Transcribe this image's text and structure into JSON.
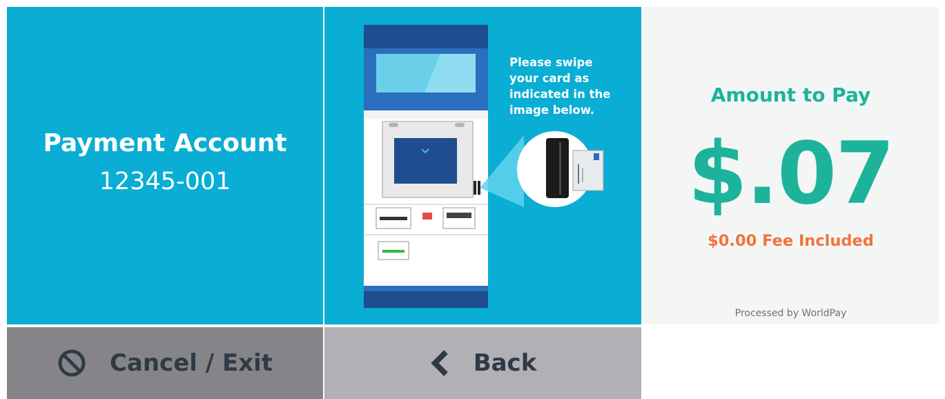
{
  "account": {
    "title": "Payment Account",
    "number": "12345-001"
  },
  "instructions": {
    "swipe_text": "Please swipe\nyour card as\nindicated in the\nimage below."
  },
  "payment": {
    "amount_label": "Amount to Pay",
    "amount": "$.07",
    "fee": "$0.00 Fee Included",
    "processor": "Processed by WorldPay"
  },
  "buttons": {
    "cancel_label": "Cancel / Exit",
    "back_label": "Back"
  },
  "icons": {
    "cancel": "no-entry-icon",
    "back": "chevron-left-icon"
  },
  "colors": {
    "panel_blue": "#0aadd3",
    "accent_green": "#1db39b",
    "fee_orange": "#f0743a",
    "cancel_bg": "#858589",
    "back_bg": "#b0b0b5"
  }
}
